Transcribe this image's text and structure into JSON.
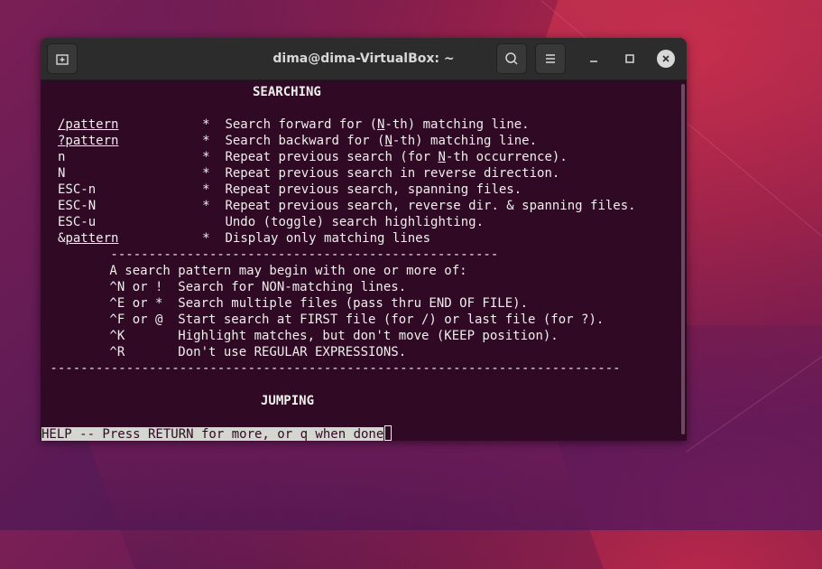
{
  "window": {
    "title": "dima@dima-VirtualBox: ~"
  },
  "icons": {
    "new_tab": "new-tab-icon",
    "search": "search-icon",
    "menu": "hamburger-menu-icon",
    "minimize": "minimize-icon",
    "maximize": "maximize-icon",
    "close": "close-icon"
  },
  "colors": {
    "terminal_bg": "#300a24",
    "terminal_fg": "#eeeeec",
    "titlebar_bg": "#2c2c2c",
    "status_bg": "#d3d7cf"
  },
  "help": {
    "heading_searching": "SEARCHING",
    "rows": [
      {
        "pre": "",
        "u": "/pattern",
        "rest": "           *  Search forward for (",
        "u2": "N",
        "rest2": "-th) matching line."
      },
      {
        "pre": "",
        "u": "?pattern",
        "rest": "           *  Search backward for (",
        "u2": "N",
        "rest2": "-th) matching line."
      },
      {
        "pre": "n",
        "u": "",
        "rest": "                  *  Repeat previous search (for ",
        "u2": "N",
        "rest2": "-th occurrence)."
      },
      {
        "pre": "N",
        "u": "",
        "rest": "                  *  Repeat previous search in reverse direction.",
        "u2": "",
        "rest2": ""
      },
      {
        "pre": "ESC-n",
        "u": "",
        "rest": "              *  Repeat previous search, spanning files.",
        "u2": "",
        "rest2": ""
      },
      {
        "pre": "ESC-N",
        "u": "",
        "rest": "              *  Repeat previous search, reverse dir. & spanning files.",
        "u2": "",
        "rest2": ""
      },
      {
        "pre": "ESC-u",
        "u": "",
        "rest": "                 Undo (toggle) search highlighting.",
        "u2": "",
        "rest2": ""
      },
      {
        "pre": "&",
        "u": "pattern",
        "rest": "           *  Display only matching lines",
        "u2": "",
        "rest2": ""
      }
    ],
    "divider_short": "        ---------------------------------------------------",
    "modifiers_intro": "        A search pattern may begin with one or more of:",
    "modifiers": [
      "        ^N or !  Search for NON-matching lines.",
      "        ^E or *  Search multiple files (pass thru END OF FILE).",
      "        ^F or @  Start search at FIRST file (for /) or last file (for ?).",
      "        ^K       Highlight matches, but don't move (KEEP position).",
      "        ^R       Don't use REGULAR EXPRESSIONS."
    ],
    "divider_long": " ---------------------------------------------------------------------------",
    "heading_jumping": "JUMPING",
    "status": "HELP -- Press RETURN for more, or q when done"
  }
}
